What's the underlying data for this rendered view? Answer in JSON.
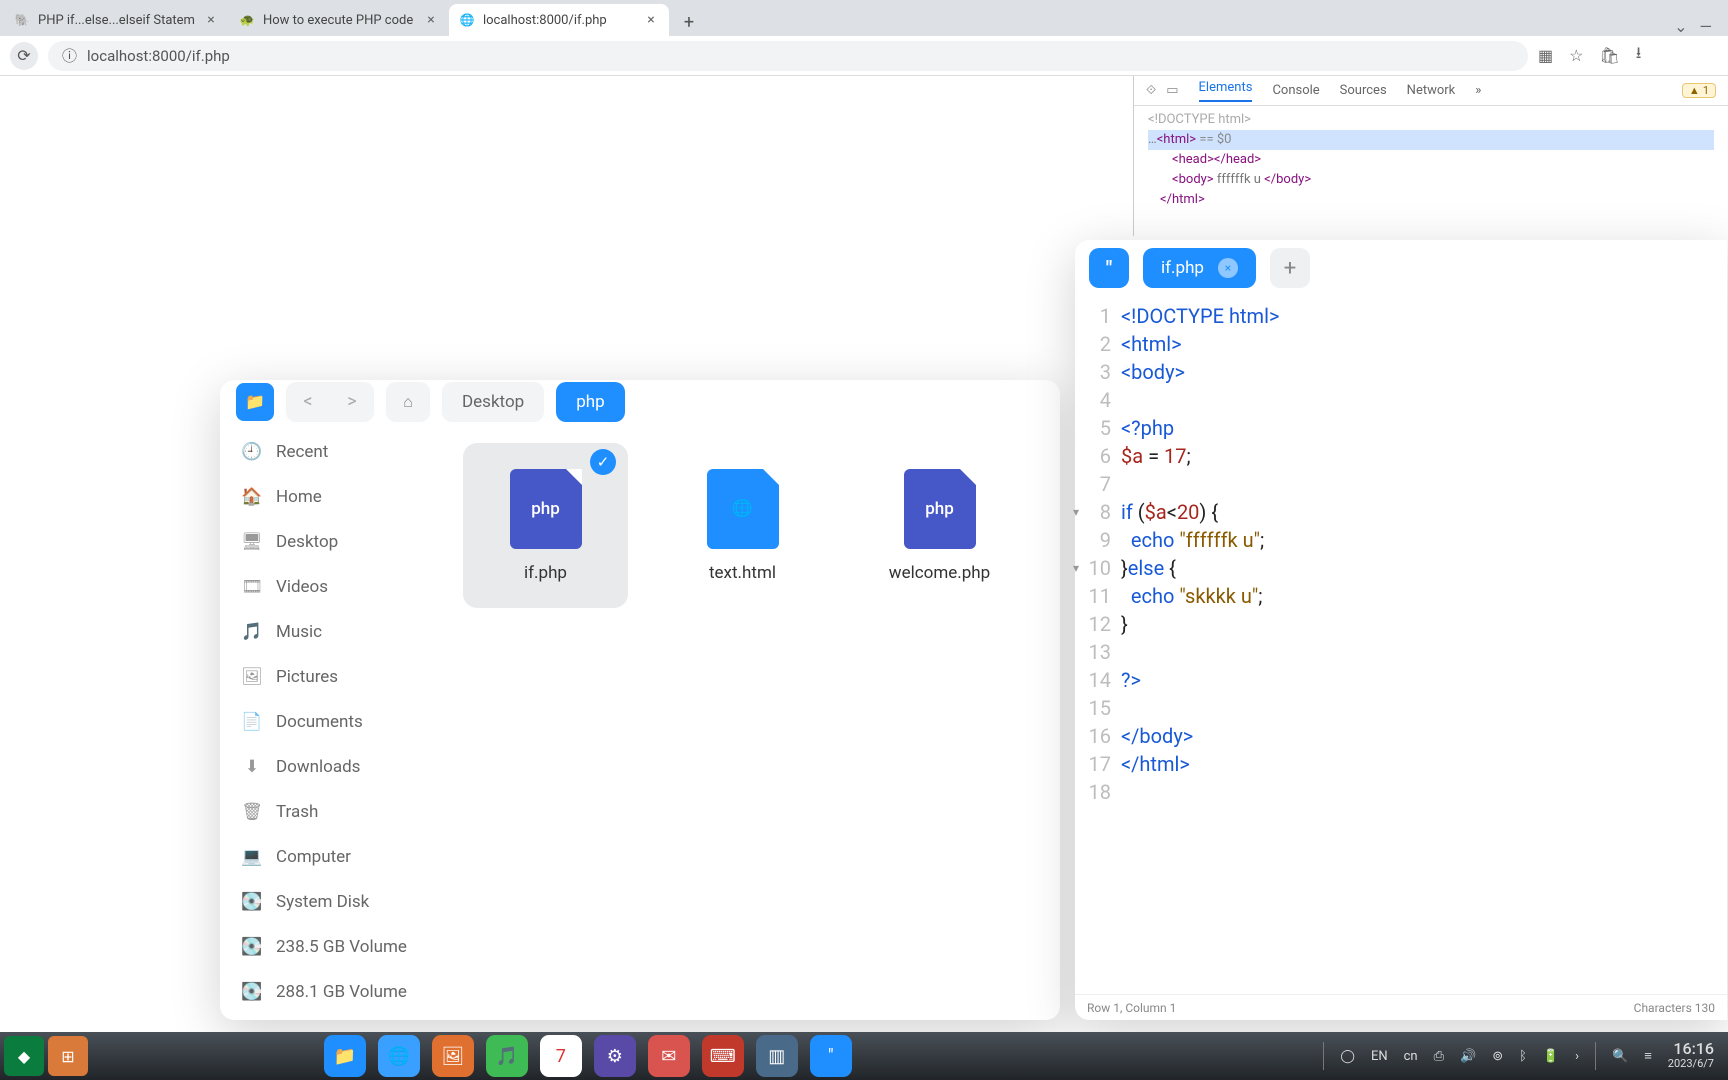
{
  "browser": {
    "tabs": [
      {
        "title": "PHP if...else...elseif Statem",
        "favicon": "🐘"
      },
      {
        "title": "How to execute PHP code",
        "favicon": "🐢"
      },
      {
        "title": "localhost:8000/if.php",
        "favicon": "🌐"
      }
    ],
    "active_tab": 2,
    "url": "localhost:8000/if.php"
  },
  "devtools": {
    "tabs": [
      "Elements",
      "Console",
      "Sources",
      "Network"
    ],
    "active": "Elements",
    "warn_count": "1",
    "dom": {
      "doctype": "<!DOCTYPE html>",
      "html_open": "<html>",
      "eq": "== $0",
      "head": "<head></head>",
      "body_open": "<body>",
      "body_text": " ffffffk u ",
      "body_close": "</body>",
      "html_close": "</html>"
    }
  },
  "editor": {
    "tab_name": "if.php",
    "status_left": "Row 1, Column 1",
    "status_right": "Characters 130",
    "lines": [
      {
        "n": 1,
        "html": "<span class='tk-tag'>&lt;!DOCTYPE html&gt;</span>"
      },
      {
        "n": 2,
        "html": "<span class='tk-tag'>&lt;html&gt;</span>"
      },
      {
        "n": 3,
        "html": "<span class='tk-tag'>&lt;body&gt;</span>"
      },
      {
        "n": 4,
        "html": ""
      },
      {
        "n": 5,
        "html": "<span class='tk-tag'>&lt;?php</span>"
      },
      {
        "n": 6,
        "html": "<span class='tk-var'>$a</span> = <span class='tk-num'>17</span>;"
      },
      {
        "n": 7,
        "html": ""
      },
      {
        "n": 8,
        "html": "<span class='tk-kw'>if</span> (<span class='tk-var'>$a</span>&lt;<span class='tk-num'>20</span>) {",
        "fold": true
      },
      {
        "n": 9,
        "html": "  <span class='tk-kw'>echo</span> <span class='tk-str'>\"ffffffk u\"</span>;"
      },
      {
        "n": 10,
        "html": "}<span class='tk-kw'>else</span> {",
        "fold": true
      },
      {
        "n": 11,
        "html": "  <span class='tk-kw'>echo</span> <span class='tk-str'>\"skkkk u\"</span>;"
      },
      {
        "n": 12,
        "html": "}"
      },
      {
        "n": 13,
        "html": ""
      },
      {
        "n": 14,
        "html": "<span class='tk-tag'>?&gt;</span>"
      },
      {
        "n": 15,
        "html": ""
      },
      {
        "n": 16,
        "html": "<span class='tk-tag'>&lt;/body&gt;</span>"
      },
      {
        "n": 17,
        "html": "<span class='tk-tag'>&lt;/html&gt;</span>"
      },
      {
        "n": 18,
        "html": ""
      }
    ]
  },
  "filemanager": {
    "breadcrumbs": [
      "Desktop",
      "php"
    ],
    "sidebar": [
      {
        "icon": "🕘",
        "label": "Recent"
      },
      {
        "icon": "🏠",
        "label": "Home"
      },
      {
        "icon": "🖥",
        "label": "Desktop"
      },
      {
        "icon": "🎞",
        "label": "Videos"
      },
      {
        "icon": "🎵",
        "label": "Music"
      },
      {
        "icon": "🖼",
        "label": "Pictures"
      },
      {
        "icon": "📄",
        "label": "Documents"
      },
      {
        "icon": "⬇",
        "label": "Downloads"
      },
      {
        "icon": "🗑",
        "label": "Trash"
      },
      {
        "icon": "💻",
        "label": "Computer"
      },
      {
        "icon": "💽",
        "label": "System Disk"
      },
      {
        "icon": "💽",
        "label": "238.5 GB Volume"
      },
      {
        "icon": "💽",
        "label": "288.1 GB Volume"
      }
    ],
    "files": [
      {
        "name": "if.php",
        "kind": "php",
        "selected": true
      },
      {
        "name": "text.html",
        "kind": "html",
        "selected": false
      },
      {
        "name": "welcome.php",
        "kind": "php",
        "selected": false
      }
    ]
  },
  "taskbar": {
    "lang": "EN",
    "ime": "cn",
    "date_day": "7",
    "time": "16:16",
    "date": "2023/6/7"
  }
}
